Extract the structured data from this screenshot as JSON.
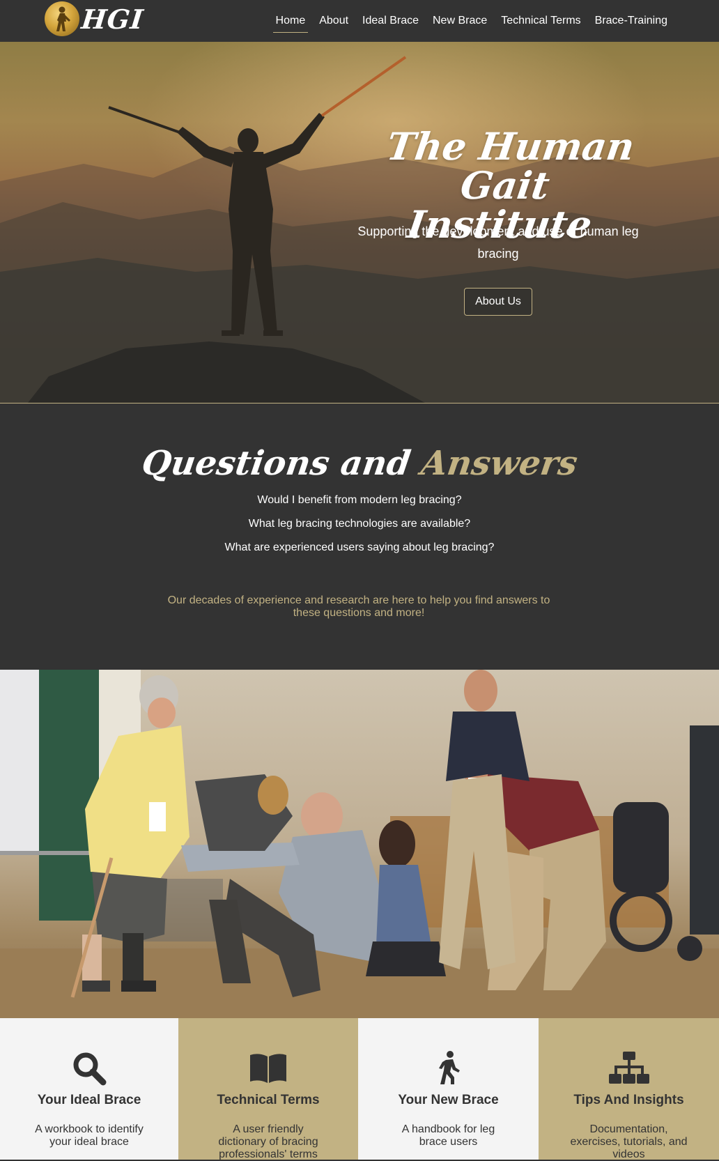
{
  "brand": {
    "name": "HGI",
    "logo": "walking-man-emblem"
  },
  "nav": {
    "items": [
      {
        "label": "Home",
        "active": true
      },
      {
        "label": "About"
      },
      {
        "label": "Ideal Brace"
      },
      {
        "label": "New Brace"
      },
      {
        "label": "Technical Terms"
      },
      {
        "label": "Brace-Training"
      }
    ]
  },
  "hero": {
    "title_line1": "The Human Gait",
    "title_line2": "Institute",
    "subtitle": "Supporting the development and use of human leg bracing",
    "button_label": "About Us"
  },
  "qa": {
    "title_word1": "Questions and",
    "title_word2": "Answers",
    "questions": [
      "Would I benefit from modern leg bracing?",
      "What leg bracing technologies are available?",
      "What are experienced users saying about leg bracing?"
    ],
    "note": "Our decades of experience and research are here to help you find answers to these questions and more!"
  },
  "cards": [
    {
      "title": "Your Ideal Brace",
      "desc": "A workbook to identify your ideal brace",
      "icon": "search-icon"
    },
    {
      "title": "Technical Terms",
      "desc": "A user friendly dictionary of bracing professionals' terms",
      "icon": "book-icon"
    },
    {
      "title": "Your New Brace",
      "desc": "A handbook for leg brace users",
      "icon": "walking-person-icon"
    },
    {
      "title": "Tips And Insights",
      "desc": "Documentation, exercises, tutorials, and videos",
      "icon": "sitemap-icon"
    }
  ],
  "colors": {
    "dark": "#333333",
    "accent": "#c2b283",
    "light": "#f4f4f4"
  }
}
